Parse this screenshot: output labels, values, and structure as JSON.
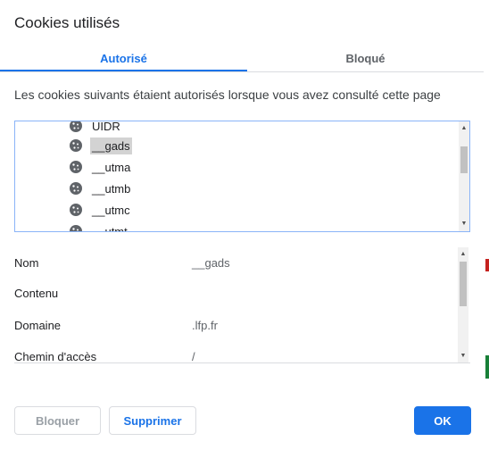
{
  "dialog": {
    "title": "Cookies utilisés"
  },
  "tabs": [
    {
      "label": "Autorisé",
      "active": true
    },
    {
      "label": "Bloqué",
      "active": false
    }
  ],
  "description": "Les cookies suivants étaient autorisés lorsque vous avez consulté cette page",
  "tree": {
    "items": [
      {
        "label": "UIDR",
        "icon": "cookie-icon"
      },
      {
        "label": "__gads",
        "icon": "cookie-icon",
        "selected": true
      },
      {
        "label": "__utma",
        "icon": "cookie-icon"
      },
      {
        "label": "__utmb",
        "icon": "cookie-icon"
      },
      {
        "label": "__utmc",
        "icon": "cookie-icon"
      },
      {
        "label": "__utmt",
        "icon": "cookie-icon"
      }
    ]
  },
  "details": {
    "rows": [
      {
        "label": "Nom",
        "value": "__gads"
      },
      {
        "label": "Contenu",
        "value": ""
      },
      {
        "label": "Domaine",
        "value": ".lfp.fr"
      },
      {
        "label": "Chemin d'accès",
        "value": "/"
      }
    ]
  },
  "buttons": {
    "block_label": "Bloquer",
    "delete_label": "Supprimer",
    "ok_label": "OK"
  },
  "colors": {
    "accent": "#1a73e8",
    "focus_border": "#8ab4f8"
  }
}
